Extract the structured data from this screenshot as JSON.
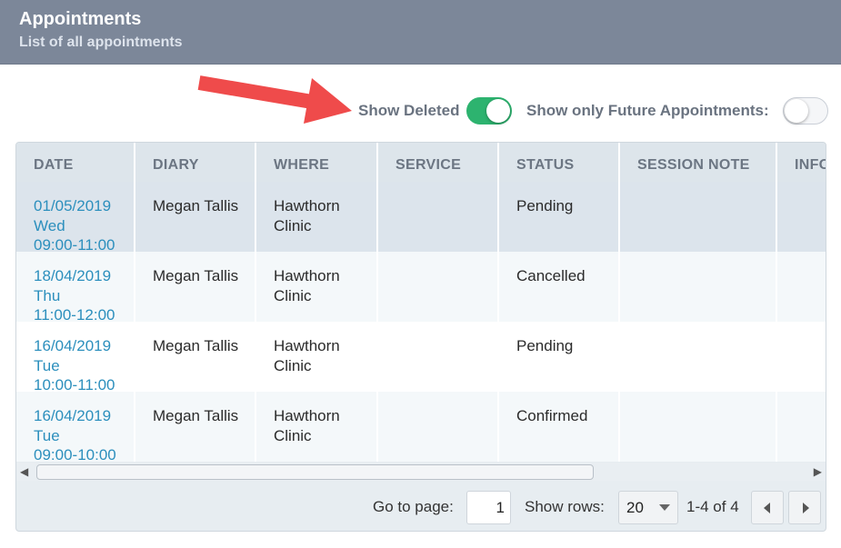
{
  "header": {
    "title": "Appointments",
    "subtitle": "List of all appointments"
  },
  "colors": {
    "header_bg": "#7c8799",
    "toggle_on": "#2db36f",
    "annotation_arrow": "#ef4b4b",
    "date_link": "#2c8fbd"
  },
  "filters": {
    "show_deleted_label": "Show Deleted",
    "show_deleted": true,
    "future_only_label": "Show only Future Appointments:",
    "future_only": false
  },
  "table": {
    "columns": [
      "DATE",
      "DIARY",
      "WHERE",
      "SERVICE",
      "STATUS",
      "SESSION NOTE",
      "INFO"
    ],
    "rows": [
      {
        "date": "01/05/2019",
        "day": "Wed",
        "time": "09:00-11:00",
        "diary": "Megan Tallis",
        "where_1": "Hawthorn",
        "where_2": "Clinic",
        "service": "",
        "status": "Pending",
        "session_note": "",
        "info": ""
      },
      {
        "date": "18/04/2019",
        "day": "Thu",
        "time": "11:00-12:00",
        "diary": "Megan Tallis",
        "where_1": "Hawthorn",
        "where_2": "Clinic",
        "service": "",
        "status": "Cancelled",
        "session_note": "",
        "info": ""
      },
      {
        "date": "16/04/2019",
        "day": "Tue",
        "time": "10:00-11:00",
        "diary": "Megan Tallis",
        "where_1": "Hawthorn",
        "where_2": "Clinic",
        "service": "",
        "status": "Pending",
        "session_note": "",
        "info": ""
      },
      {
        "date": "16/04/2019",
        "day": "Tue",
        "time": "09:00-10:00",
        "diary": "Megan Tallis",
        "where_1": "Hawthorn",
        "where_2": "Clinic",
        "service": "",
        "status": "Confirmed",
        "session_note": "",
        "info": ""
      }
    ]
  },
  "pager": {
    "go_to_page_label": "Go to page:",
    "page_value": "1",
    "show_rows_label": "Show rows:",
    "rows_value": "20",
    "range_text": "1-4 of 4"
  }
}
